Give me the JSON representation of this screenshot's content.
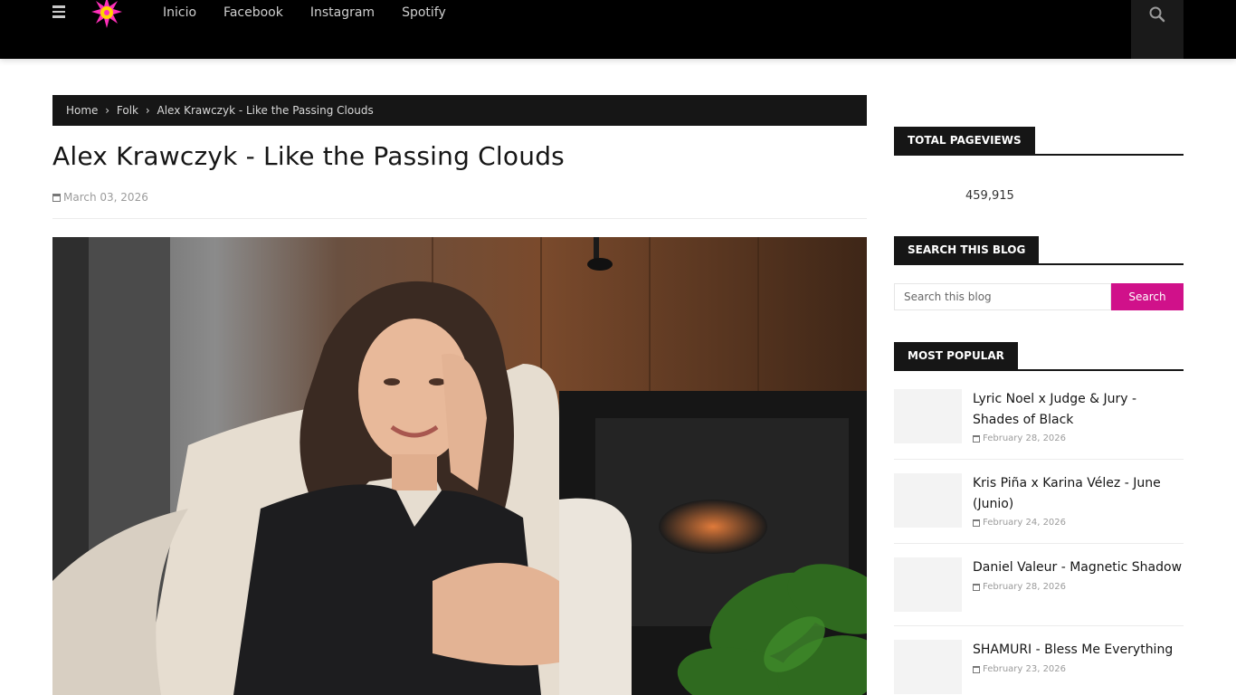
{
  "nav": {
    "links": [
      "Inicio",
      "Facebook",
      "Instagram",
      "Spotify"
    ]
  },
  "breadcrumb": {
    "home": "Home",
    "category": "Folk",
    "current": "Alex Krawczyk - Like the Passing Clouds",
    "separator": "›"
  },
  "post": {
    "title": "Alex Krawczyk - Like the Passing Clouds",
    "date": "March 03, 2026"
  },
  "sidebar": {
    "pageviews": {
      "heading": "TOTAL PAGEVIEWS",
      "count": "459,915"
    },
    "search": {
      "heading": "SEARCH THIS BLOG",
      "placeholder": "Search this blog",
      "button": "Search"
    },
    "popular": {
      "heading": "MOST POPULAR",
      "items": [
        {
          "title": "Lyric Noel x Judge & Jury - Shades of Black",
          "date": "February 28, 2026"
        },
        {
          "title": "Kris Piña x Karina Vélez - June (Junio)",
          "date": "February 24, 2026"
        },
        {
          "title": "Daniel Valeur - Magnetic Shadow",
          "date": "February 28, 2026"
        },
        {
          "title": "SHAMURI - Bless Me Everything",
          "date": "February 23, 2026"
        }
      ]
    }
  },
  "colors": {
    "accent": "#d0118a",
    "topbar": "#000000",
    "widget_head": "#161616"
  }
}
